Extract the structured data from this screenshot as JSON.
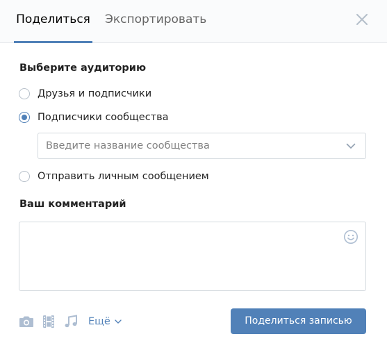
{
  "tabs": [
    {
      "label": "Поделиться",
      "active": true
    },
    {
      "label": "Экспортировать",
      "active": false
    }
  ],
  "audience": {
    "title": "Выберите аудиторию",
    "options": [
      {
        "label": "Друзья и подписчики",
        "checked": false
      },
      {
        "label": "Подписчики сообщества",
        "checked": true
      },
      {
        "label": "Отправить личным сообщением",
        "checked": false
      }
    ],
    "community_select": {
      "placeholder": "Введите название сообщества"
    }
  },
  "comment": {
    "title": "Ваш комментарий",
    "value": ""
  },
  "attachments": {
    "icons": [
      "camera-icon",
      "film-icon",
      "music-note-icon",
      "chevron-down-icon"
    ],
    "more_label": "Ещё"
  },
  "submit_label": "Поделиться записью",
  "colors": {
    "accent": "#5181b8",
    "header_bg": "#fafbfc",
    "icon": "#aebed2",
    "border": "#d3d9de"
  }
}
